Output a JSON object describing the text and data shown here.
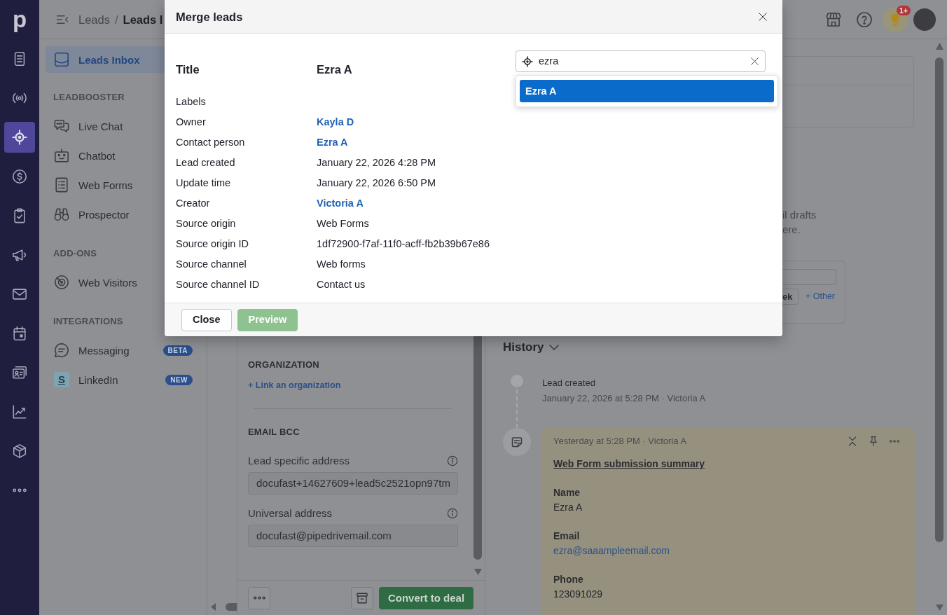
{
  "rail": {
    "logo": "p",
    "items": [
      {
        "selected": false
      },
      {
        "selected": false
      },
      {
        "selected": true
      },
      {
        "selected": false
      },
      {
        "selected": false
      },
      {
        "selected": false
      },
      {
        "selected": false
      },
      {
        "selected": false
      },
      {
        "selected": false
      },
      {
        "selected": false
      },
      {
        "selected": false
      },
      {
        "selected": false
      }
    ]
  },
  "top_bar": {
    "breadcrumb": [
      {
        "label": "Leads",
        "current": false
      },
      {
        "label": "Leads I",
        "current": true
      }
    ],
    "separator": "/",
    "notification_badge": "1+"
  },
  "sidebar": {
    "sections": [
      {
        "items": [
          {
            "label": "Leads Inbox",
            "selected": true
          }
        ]
      },
      {
        "heading": "LEADBOOSTER",
        "items": [
          {
            "label": "Live Chat",
            "selected": false
          },
          {
            "label": "Chatbot",
            "selected": false
          },
          {
            "label": "Web Forms",
            "selected": false
          },
          {
            "label": "Prospector",
            "selected": false
          }
        ]
      },
      {
        "heading": "ADD-ONS",
        "items": [
          {
            "label": "Web Visitors",
            "selected": false
          }
        ]
      },
      {
        "heading": "INTEGRATIONS",
        "items": [
          {
            "label": "Messaging",
            "selected": false,
            "badge": "BETA"
          },
          {
            "label": "LinkedIn",
            "selected": false,
            "badge": "NEW",
            "icon_letter": "S"
          }
        ]
      }
    ]
  },
  "lead_panel": {
    "organization": {
      "heading": "ORGANIZATION",
      "link": "+ Link an organization"
    },
    "email_bcc": {
      "heading": "EMAIL BCC",
      "fields": [
        {
          "label": "Lead specific address",
          "value": "docufast+14627609+lead5c2521opn97tm"
        },
        {
          "label": "Universal address",
          "value": "docufast@pipedrivemail.com"
        }
      ]
    },
    "actions": {
      "convert_button": "Convert to deal"
    }
  },
  "right_panel": {
    "description": [
      "il drafts",
      "ere."
    ],
    "quick_options": {
      "button": "ek",
      "link": "+ Other"
    },
    "history": {
      "title": "History",
      "events": [
        {
          "kind": "activity",
          "title": "Lead created",
          "meta": "January 22, 2026 at 5:28 PM · Victoria A"
        },
        {
          "kind": "note",
          "meta": "Yesterday at 5:28 PM · Victoria A",
          "heading": "Web Form submission summary",
          "fields": [
            {
              "label": "Name",
              "value": "Ezra A",
              "link": false
            },
            {
              "label": "Email",
              "value": "ezra@saaampleemail.com",
              "link": true
            },
            {
              "label": "Phone",
              "value": "123091029",
              "link": false
            }
          ]
        }
      ]
    }
  },
  "modal": {
    "title": "Merge leads",
    "rows": [
      {
        "kind": "title",
        "label": "Title",
        "value": "Ezra A"
      },
      {
        "kind": "text",
        "label": "Labels"
      },
      {
        "kind": "link",
        "label": "Owner",
        "value": "Kayla D"
      },
      {
        "kind": "link",
        "label": "Contact person",
        "value": "Ezra A"
      },
      {
        "kind": "text",
        "label": "Lead created",
        "value": "January 22, 2026 4:28 PM"
      },
      {
        "kind": "text",
        "label": "Update time",
        "value": "January 22, 2026 6:50 PM"
      },
      {
        "kind": "link",
        "label": "Creator",
        "value": "Victoria A"
      },
      {
        "kind": "text",
        "label": "Source origin",
        "value": "Web Forms"
      },
      {
        "kind": "text",
        "label": "Source origin ID",
        "value": "1df72900-f7af-11f0-acff-fb2b39b67e86"
      },
      {
        "kind": "text",
        "label": "Source channel",
        "value": "Web forms"
      },
      {
        "kind": "text",
        "label": "Source channel ID",
        "value": "Contact us"
      }
    ],
    "search": {
      "value": "ezra",
      "results": [
        {
          "label": "Ezra A",
          "selected": true
        }
      ]
    },
    "buttons": [
      {
        "label": "Close",
        "kind": "secondary",
        "disabled": false
      },
      {
        "label": "Preview",
        "kind": "primary",
        "disabled": true
      }
    ]
  }
}
